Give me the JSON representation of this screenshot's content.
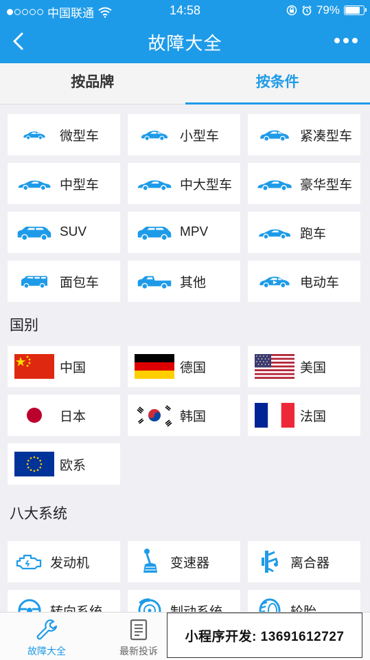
{
  "status_bar": {
    "carrier": "中国联通",
    "time": "14:58",
    "battery": "79%",
    "battery_level": 0.79
  },
  "nav": {
    "title": "故障大全"
  },
  "tabs": [
    {
      "label": "按品牌"
    },
    {
      "label": "按条件"
    }
  ],
  "vehicle_types": [
    {
      "label": "微型车"
    },
    {
      "label": "小型车"
    },
    {
      "label": "紧凑型车"
    },
    {
      "label": "中型车"
    },
    {
      "label": "中大型车"
    },
    {
      "label": "豪华型车"
    },
    {
      "label": "SUV"
    },
    {
      "label": "MPV"
    },
    {
      "label": "跑车"
    },
    {
      "label": "面包车"
    },
    {
      "label": "其他"
    },
    {
      "label": "电动车"
    }
  ],
  "countries_section": {
    "title": "国别",
    "items": [
      {
        "label": "中国"
      },
      {
        "label": "德国"
      },
      {
        "label": "美国"
      },
      {
        "label": "日本"
      },
      {
        "label": "韩国"
      },
      {
        "label": "法国"
      },
      {
        "label": "欧系"
      }
    ]
  },
  "systems_section": {
    "title": "八大系统",
    "items": [
      {
        "label": "发动机"
      },
      {
        "label": "变速器"
      },
      {
        "label": "离合器"
      },
      {
        "label": "转向系统"
      },
      {
        "label": "制动系统"
      },
      {
        "label": "轮胎"
      }
    ]
  },
  "bottom_tabs": [
    {
      "label": "故障大全"
    },
    {
      "label": "最新投诉"
    }
  ],
  "promo": {
    "text": "小程序开发:  13691612727"
  },
  "colors": {
    "primary": "#1e9be8",
    "background": "#efeff4"
  }
}
